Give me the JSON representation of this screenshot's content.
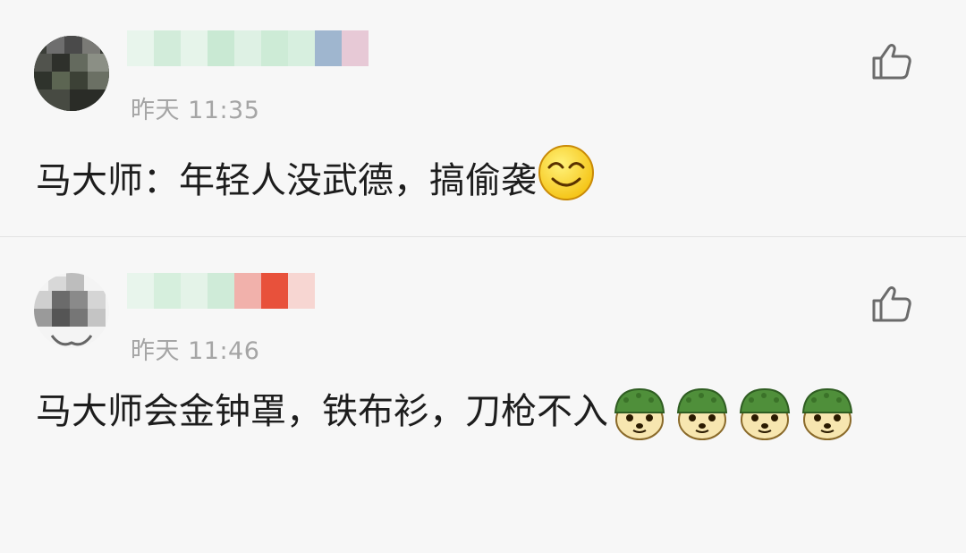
{
  "comments": [
    {
      "time": "昨天 11:35",
      "text": "马大师：年轻人没武德，搞偷袭",
      "emoji_icons": [
        "grinning-squint-emoji-icon"
      ]
    },
    {
      "time": "昨天 11:46",
      "text": "马大师会金钟罩，铁布衫，刀枪不入",
      "emoji_icons": [
        "doge-helmet-emoji-icon",
        "doge-helmet-emoji-icon",
        "doge-helmet-emoji-icon",
        "doge-helmet-emoji-icon"
      ]
    }
  ],
  "colors": {
    "background": "#f7f7f7",
    "text": "#1d1d1d",
    "timestamp": "#a5a5a5",
    "divider": "#e3e3e3",
    "like_icon": "#6b6b6b"
  }
}
